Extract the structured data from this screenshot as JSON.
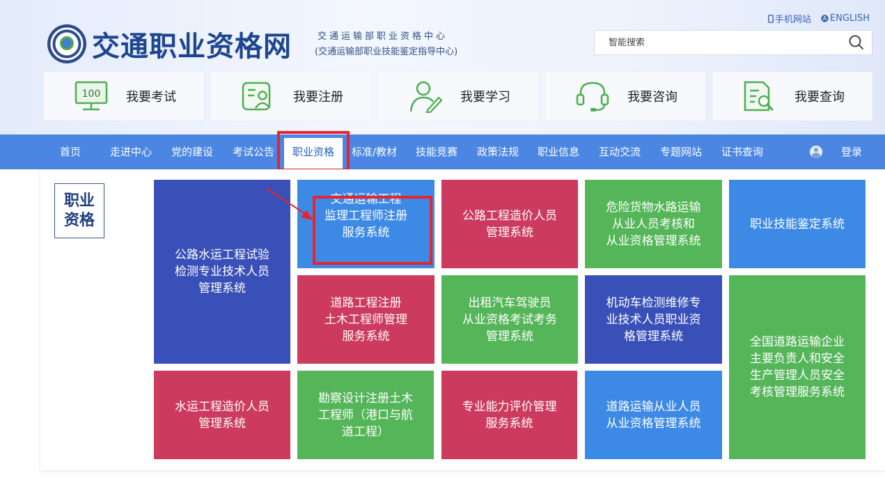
{
  "header": {
    "site_title": "交通职业资格网",
    "org_line1": "交通运输部职业资格中心",
    "org_line2": "(交通运输部职业技能鉴定指导中心)",
    "top_links": [
      {
        "label": "手机网站",
        "icon": "mobile-icon"
      },
      {
        "label": "ENGLISH",
        "icon": "english-icon"
      }
    ],
    "search": {
      "placeholder": "智能搜索",
      "icon": "search-icon"
    }
  },
  "quick_actions": [
    {
      "label": "我要考试",
      "icon": "exam-monitor-icon"
    },
    {
      "label": "我要注册",
      "icon": "register-user-icon"
    },
    {
      "label": "我要学习",
      "icon": "study-person-icon"
    },
    {
      "label": "我要咨询",
      "icon": "headset-icon"
    },
    {
      "label": "我要查询",
      "icon": "document-search-icon"
    }
  ],
  "nav": {
    "items": [
      "首页",
      "走进中心",
      "党的建设",
      "考试公告",
      "职业资格",
      "标准/教材",
      "技能竞赛",
      "政策法规",
      "职业信息",
      "互动交流",
      "专题网站",
      "证书查询"
    ],
    "active": "职业资格",
    "login_label": "登录",
    "accent_color": "#4a86e2",
    "highlight_color": "#e8232d"
  },
  "section": {
    "category_label": "职业\n资格"
  },
  "systems": [
    {
      "label": "公路水运工程试验\n检测专业技术人员\n管理系统",
      "color": "#3950b8"
    },
    {
      "label": "交通运输工程\n监理工程师注册\n服务系统",
      "color": "#3d8ae6",
      "highlighted": true
    },
    {
      "label": "公路工程造价人员\n管理系统",
      "color": "#cc3b5d"
    },
    {
      "label": "危险货物水路运输\n从业人员考核和\n从业资格管理系统",
      "color": "#55b559"
    },
    {
      "label": "职业技能鉴定系统",
      "color": "#3d8ae6"
    },
    {
      "label": "道路工程注册\n土木工程师管理\n服务系统",
      "color": "#cc3b5d"
    },
    {
      "label": "出租汽车驾驶员\n从业资格考试考务\n管理系统",
      "color": "#55b559"
    },
    {
      "label": "机动车检测维修专\n业技术人员职业资\n格管理系统",
      "color": "#3950b8"
    },
    {
      "label": "全国道路运输企业\n主要负责人和安全\n生产管理人员安全\n考核管理服务系统",
      "color": "#55b559"
    },
    {
      "label": "水运工程造价人员\n管理系统",
      "color": "#cc3b5d"
    },
    {
      "label": "勘察设计注册土木\n工程师（港口与航\n道工程）",
      "color": "#55b559"
    },
    {
      "label": "专业能力评价管理\n服务系统",
      "color": "#cc3b5d"
    },
    {
      "label": "道路运输从业人员\n从业资格管理系统",
      "color": "#3d8ae6"
    }
  ]
}
